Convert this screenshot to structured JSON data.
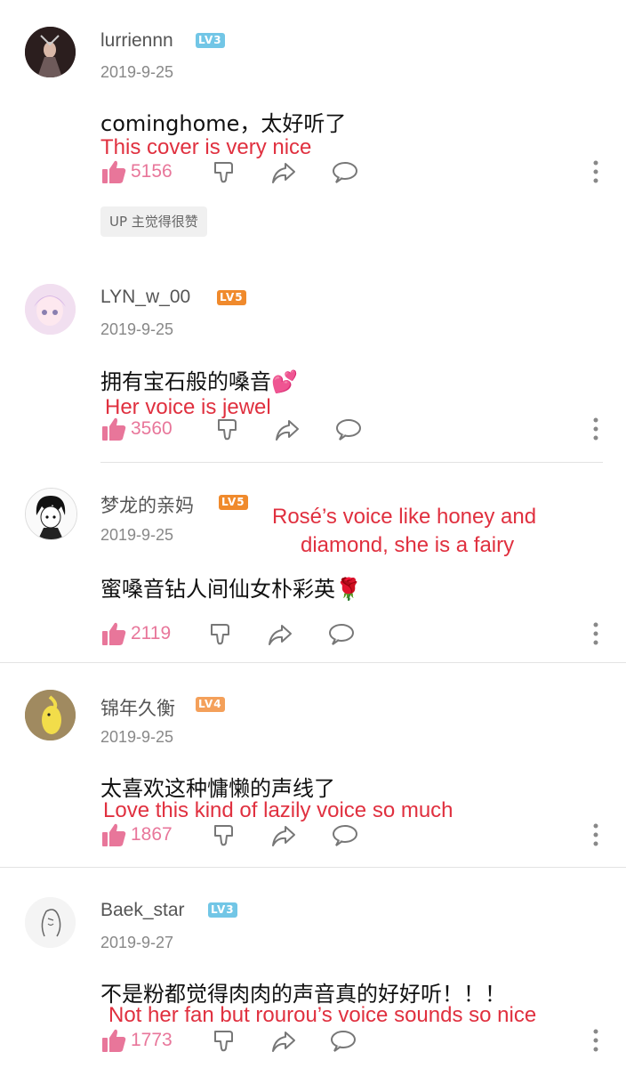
{
  "colors": {
    "lv3": "#72c6e6",
    "lv5": "#f08a2c",
    "lv4": "#f4a05a",
    "translation": "#e0303f",
    "like": "#e8769a"
  },
  "comments": [
    {
      "username": "lurriennn",
      "level": "LV3",
      "date": "2019-9-25",
      "text": "cominghome，太好听了",
      "translation": "This cover is very nice",
      "likes": "5156",
      "badge": "UP 主觉得很赞"
    },
    {
      "username": "LYN_w_00",
      "level": "LV5",
      "date": "2019-9-25",
      "text": "拥有宝石般的嗓音💕",
      "translation": "Her voice is jewel",
      "likes": "3560"
    },
    {
      "username": "梦龙的亲妈",
      "level": "LV5",
      "date": "2019-9-25",
      "text": "蜜嗓音钻人间仙女朴彩英🌹",
      "translation_line1": "Rosé’s voice like honey and",
      "translation_line2": "diamond, she is a fairy",
      "likes": "2119"
    },
    {
      "username": "锦年久衡",
      "level": "LV4",
      "date": "2019-9-25",
      "text": "太喜欢这种慵懒的声线了",
      "translation": "Love this kind of lazily voice so much",
      "likes": "1867"
    },
    {
      "username": "Baek_star",
      "level": "LV3",
      "date": "2019-9-27",
      "text": "不是粉都觉得肉肉的声音真的好好听！！！",
      "translation": "Not her fan but rourou’s voice sounds so nice",
      "likes": "1773"
    }
  ]
}
